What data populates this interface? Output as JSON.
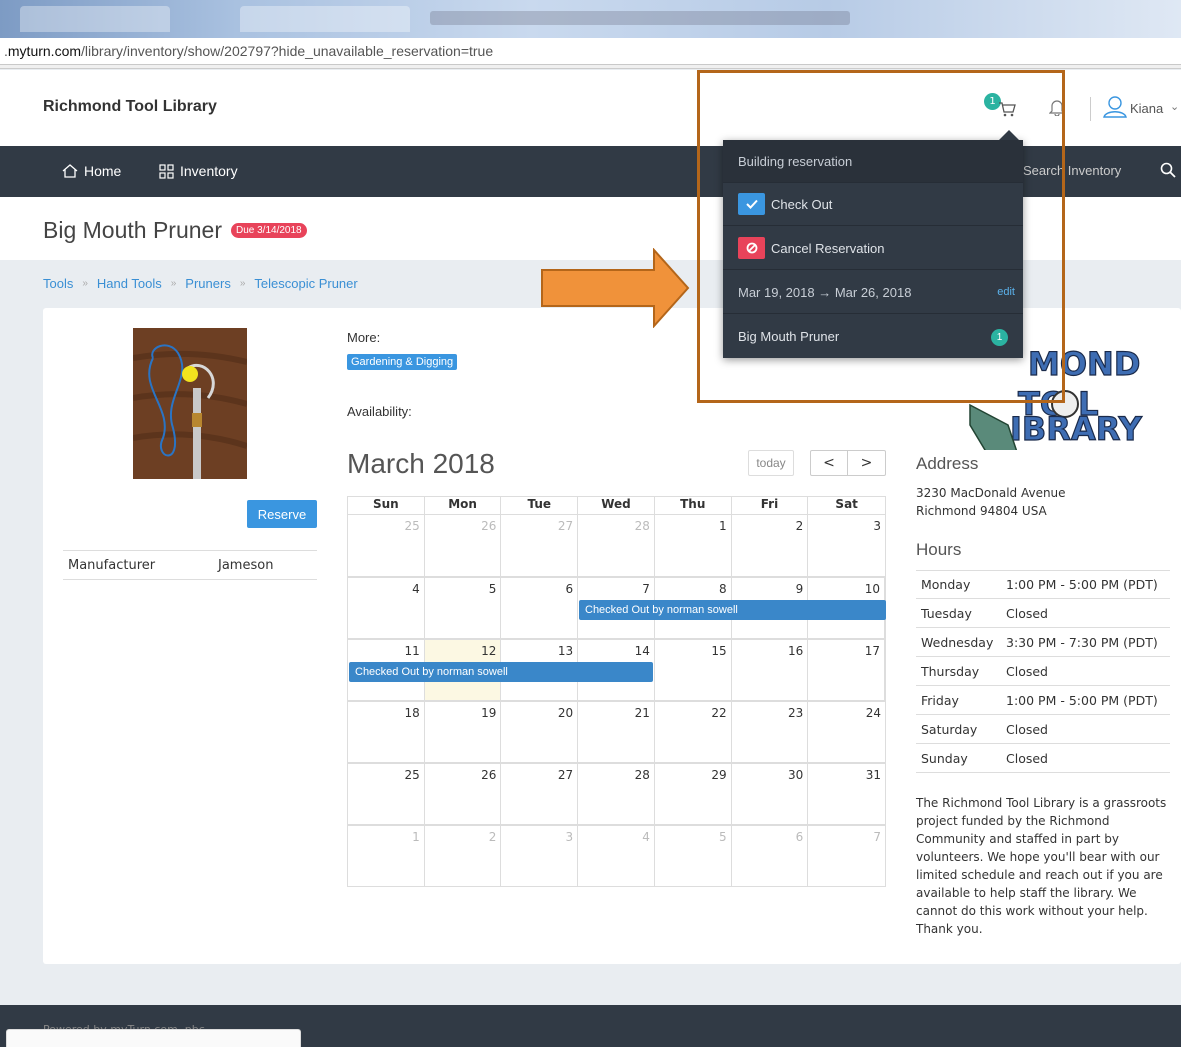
{
  "browser": {
    "url_prefix": ".",
    "url_domain": "myturn.com",
    "url_path": "/library/inventory/show/202797?hide_unavailable_reservation=true"
  },
  "header": {
    "brand": "Richmond Tool Library",
    "cart_count": "1",
    "user_name": "Kiana"
  },
  "nav": {
    "home": "Home",
    "inventory": "Inventory",
    "search_placeholder": "Search Inventory"
  },
  "item": {
    "title": "Big Mouth Pruner",
    "due_badge": "Due 3/14/2018",
    "reserve_label": "Reserve",
    "attributes": [
      {
        "key": "Manufacturer",
        "value": "Jameson"
      }
    ],
    "more_label": "More:",
    "tag": "Gardening & Digging",
    "availability_label": "Availability:"
  },
  "breadcrumb": [
    "Tools",
    "Hand Tools",
    "Pruners",
    "Telescopic Pruner"
  ],
  "calendar": {
    "title": "March 2018",
    "today_label": "today",
    "prev": "<",
    "next": ">",
    "days": [
      "Sun",
      "Mon",
      "Tue",
      "Wed",
      "Thu",
      "Fri",
      "Sat"
    ],
    "weeks": [
      [
        "25",
        "26",
        "27",
        "28",
        "1",
        "2",
        "3"
      ],
      [
        "4",
        "5",
        "6",
        "7",
        "8",
        "9",
        "10"
      ],
      [
        "11",
        "12",
        "13",
        "14",
        "15",
        "16",
        "17"
      ],
      [
        "18",
        "19",
        "20",
        "21",
        "22",
        "23",
        "24"
      ],
      [
        "25",
        "26",
        "27",
        "28",
        "29",
        "30",
        "31"
      ],
      [
        "1",
        "2",
        "3",
        "4",
        "5",
        "6",
        "7"
      ]
    ],
    "events": [
      {
        "label": "Checked Out by norman sowell"
      },
      {
        "label": "Checked Out by norman sowell"
      }
    ]
  },
  "sidebar": {
    "address_title": "Address",
    "address_line1": "3230 MacDonald Avenue",
    "address_line2": "Richmond 94804 USA",
    "hours_title": "Hours",
    "hours": [
      {
        "day": "Monday",
        "time": "1:00 PM - 5:00 PM (PDT)"
      },
      {
        "day": "Tuesday",
        "time": "Closed"
      },
      {
        "day": "Wednesday",
        "time": "3:30 PM - 7:30 PM (PDT)"
      },
      {
        "day": "Thursday",
        "time": "Closed"
      },
      {
        "day": "Friday",
        "time": "1:00 PM - 5:00 PM (PDT)"
      },
      {
        "day": "Saturday",
        "time": "Closed"
      },
      {
        "day": "Sunday",
        "time": "Closed"
      }
    ],
    "about": "The Richmond Tool Library is a grassroots project funded by the Richmond Community and staffed in part by volunteers. We hope you'll bear with our limited schedule and reach out if you are available to help staff the library. We cannot do this work without your help. Thank you."
  },
  "dropdown": {
    "heading": "Building reservation",
    "checkout_label": "Check Out",
    "cancel_label": "Cancel Reservation",
    "dates": "Mar 19, 2018 → Mar 26, 2018",
    "edit_label": "edit",
    "item_name": "Big Mouth Pruner",
    "item_count": "1"
  },
  "footer": {
    "text": "Powered by myTurn.com, pbc"
  },
  "colors": {
    "nav_bg": "#313a45",
    "accent_blue": "#3a96e0",
    "badge_red": "#e8435a",
    "teal": "#2bb3a1",
    "annotation_orange": "#f0923a",
    "annotation_border": "#b4661a"
  }
}
